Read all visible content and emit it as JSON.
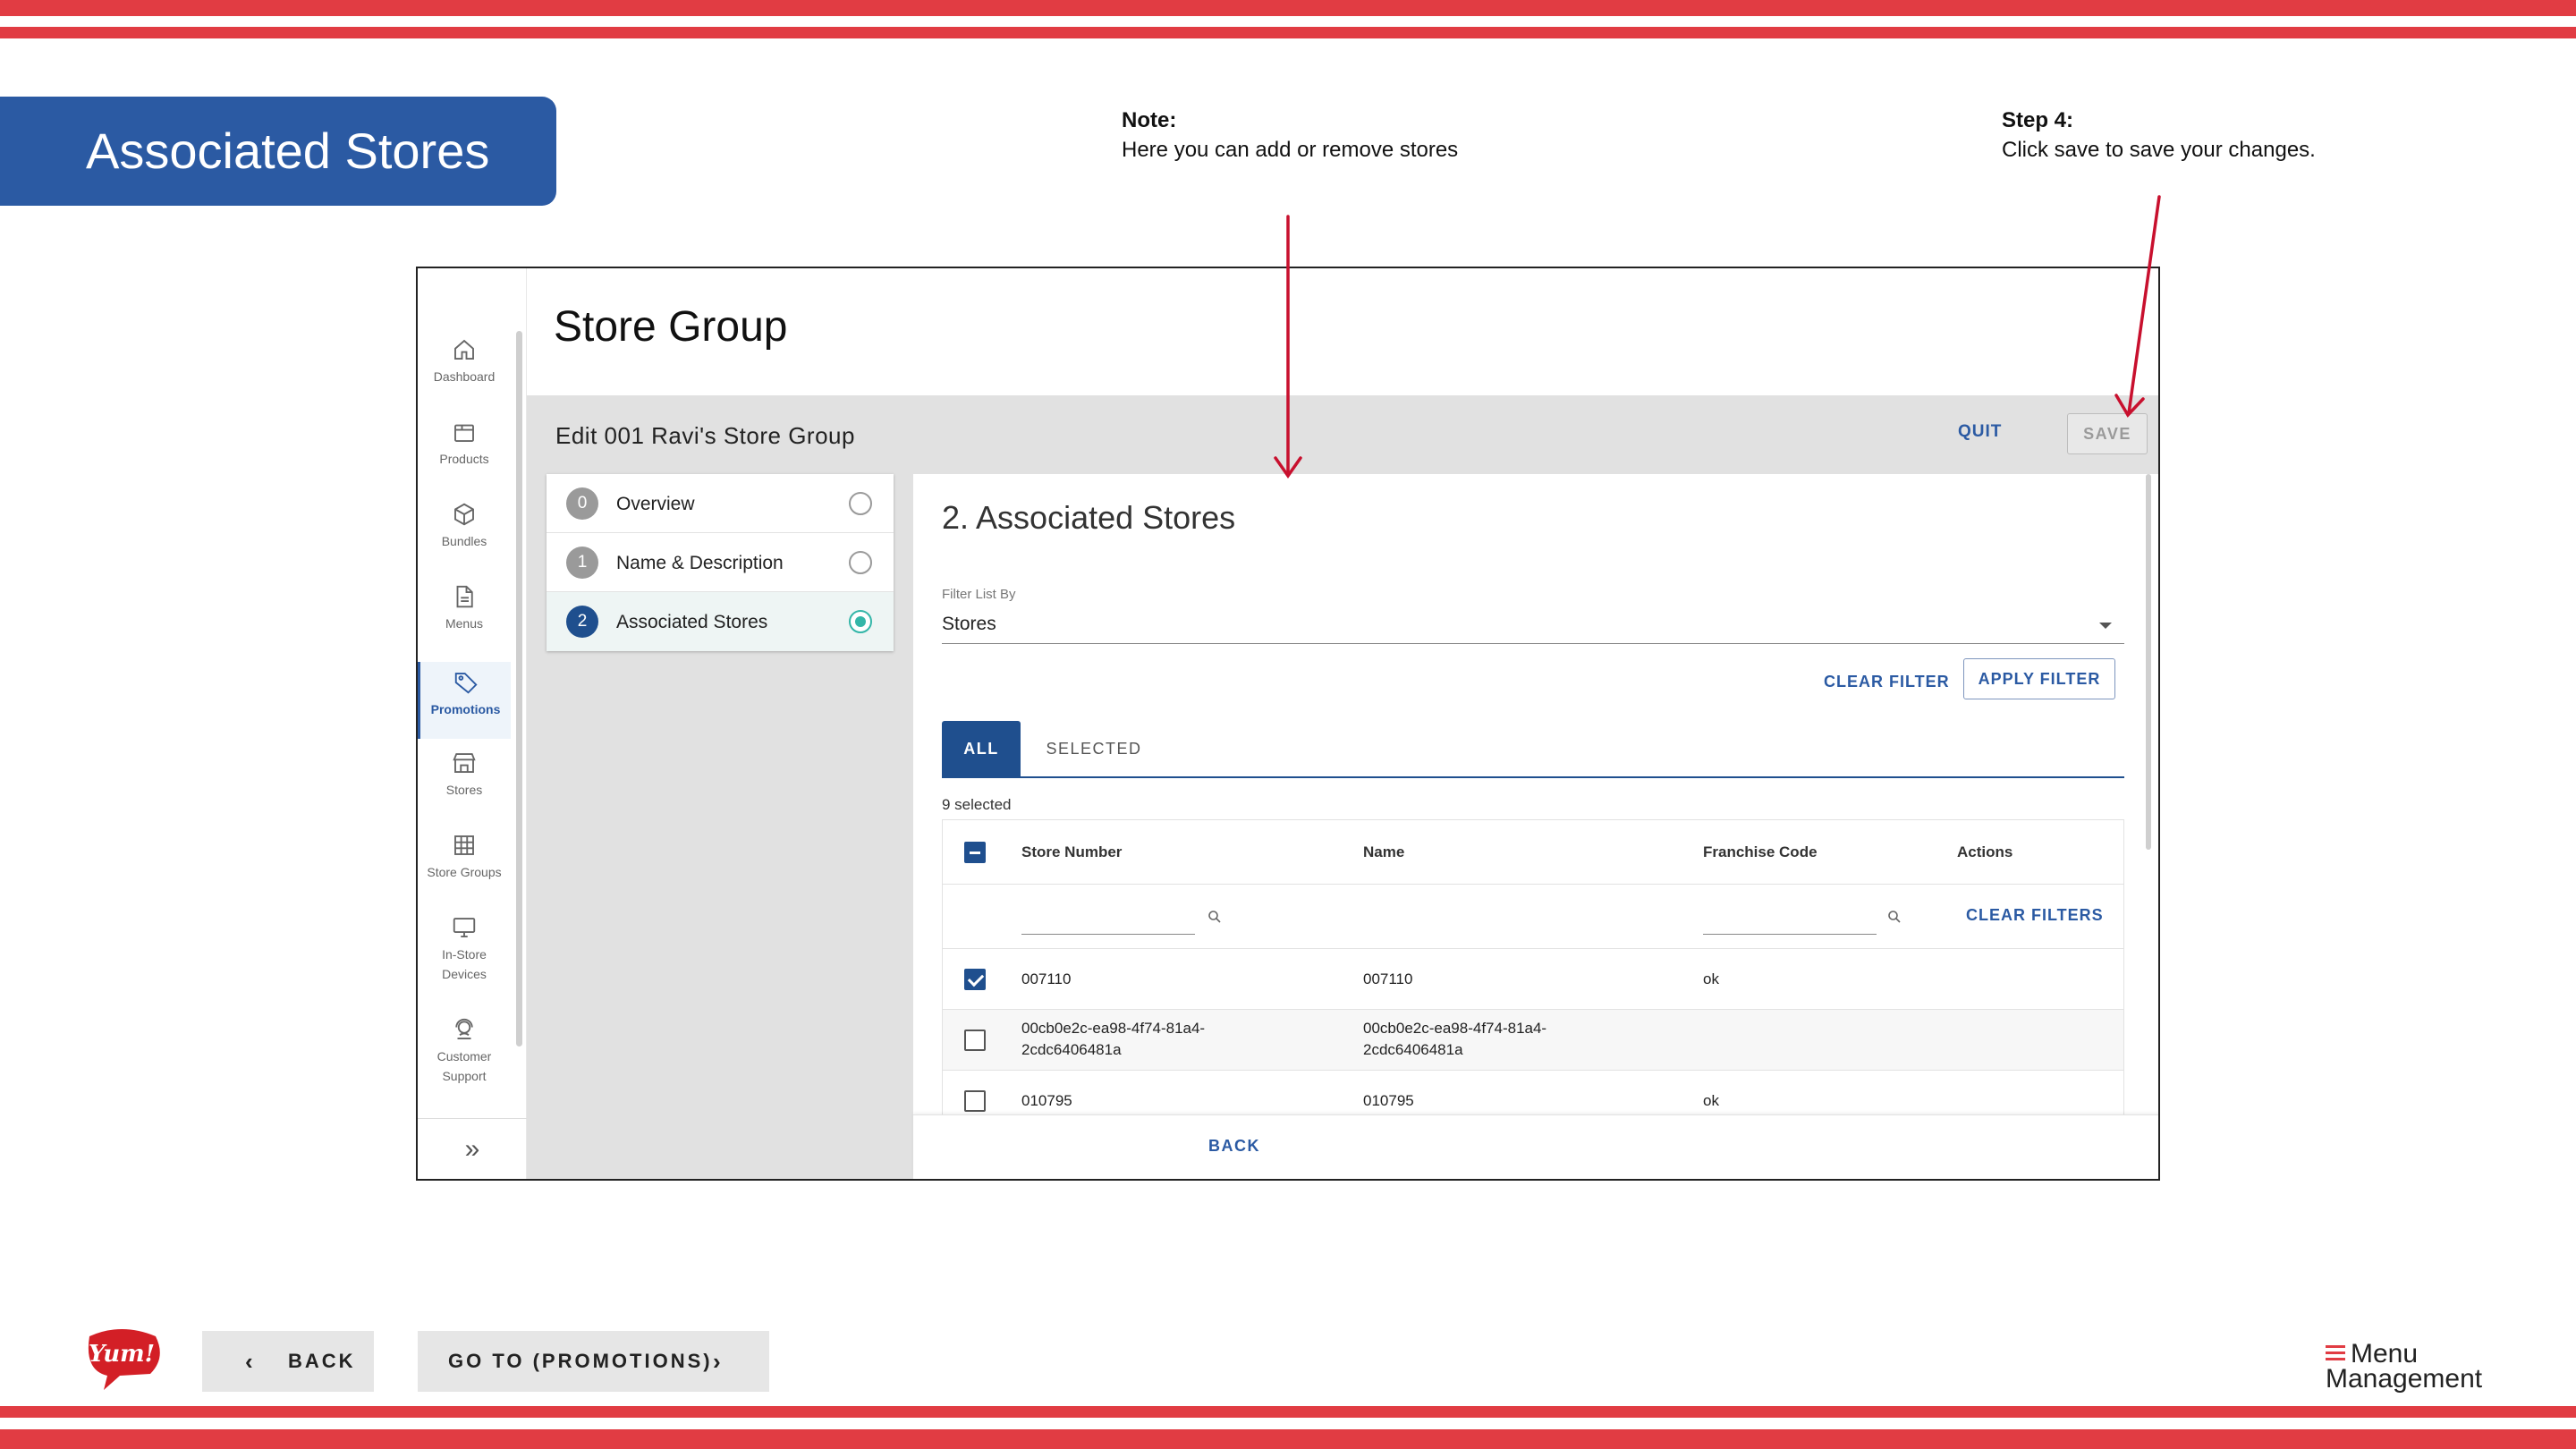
{
  "slide": {
    "title": "Associated Stores",
    "note": {
      "heading": "Note:",
      "text": "Here you can add or remove stores"
    },
    "step4": {
      "heading": "Step 4:",
      "text": "Click save to save your changes."
    },
    "accent_color": "#e13c43",
    "banner_color": "#2b5aa3"
  },
  "sidebar": {
    "items": [
      {
        "label": "Dashboard",
        "icon": "home-icon"
      },
      {
        "label": "Products",
        "icon": "box-icon"
      },
      {
        "label": "Bundles",
        "icon": "cube-icon"
      },
      {
        "label": "Menus",
        "icon": "document-icon"
      },
      {
        "label": "Promotions",
        "icon": "tag-icon",
        "active": true
      },
      {
        "label": "Stores",
        "icon": "storefront-icon"
      },
      {
        "label": "Store Groups",
        "icon": "grid-icon"
      },
      {
        "label_line1": "In-Store",
        "label_line2": "Devices",
        "icon": "monitor-icon"
      },
      {
        "label_line1": "Customer",
        "label_line2": "Support",
        "icon": "headset-icon"
      }
    ],
    "expand_icon": "double-chevron-right-icon"
  },
  "page": {
    "title": "Store Group",
    "edit_title": "Edit 001 Ravi's Store Group",
    "quit_label": "QUIT",
    "save_label": "SAVE"
  },
  "steps": [
    {
      "number": "0",
      "label": "Overview"
    },
    {
      "number": "1",
      "label": "Name & Description"
    },
    {
      "number": "2",
      "label": "Associated Stores",
      "current": true
    }
  ],
  "panel": {
    "section_title": "2. Associated Stores",
    "filter_label": "Filter List By",
    "filter_value": "Stores",
    "clear_filter_label": "CLEAR FILTER",
    "apply_filter_label": "APPLY FILTER",
    "tabs": {
      "all": "ALL",
      "selected": "SELECTED"
    },
    "selected_count": "9 selected",
    "back_label": "BACK"
  },
  "table": {
    "headers": {
      "store_number": "Store Number",
      "name": "Name",
      "franchise_code": "Franchise Code",
      "actions": "Actions"
    },
    "clear_filters_label": "CLEAR FILTERS",
    "rows": [
      {
        "checked": true,
        "store_number": "007110",
        "name": "007110",
        "franchise_code": "ok"
      },
      {
        "checked": false,
        "store_number_l1": "00cb0e2c-ea98-4f74-81a4-",
        "store_number_l2": "2cdc6406481a",
        "name_l1": "00cb0e2c-ea98-4f74-81a4-",
        "name_l2": "2cdc6406481a",
        "franchise_code": ""
      },
      {
        "checked": false,
        "store_number": "010795",
        "name": "010795",
        "franchise_code": "ok"
      }
    ]
  },
  "bottom_nav": {
    "back_label": "BACK",
    "go_label": "GO TO (PROMOTIONS)",
    "yum_logo_text": "Yum!",
    "mm_logo_line1": "Menu",
    "mm_logo_line2": "Management"
  }
}
